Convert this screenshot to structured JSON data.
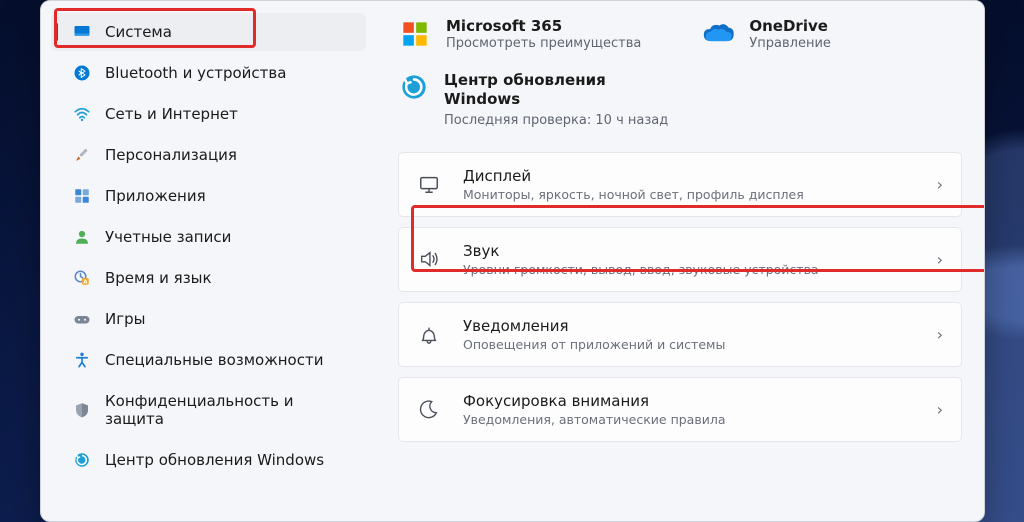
{
  "sidebar": {
    "items": [
      {
        "label": "Система",
        "icon": "display-icon",
        "active": true
      },
      {
        "label": "Bluetooth и устройства",
        "icon": "bluetooth-icon"
      },
      {
        "label": "Сеть и Интернет",
        "icon": "wifi-icon"
      },
      {
        "label": "Персонализация",
        "icon": "brush-icon"
      },
      {
        "label": "Приложения",
        "icon": "apps-icon"
      },
      {
        "label": "Учетные записи",
        "icon": "user-icon"
      },
      {
        "label": "Время и язык",
        "icon": "clock-language-icon"
      },
      {
        "label": "Игры",
        "icon": "gamepad-icon"
      },
      {
        "label": "Специальные возможности",
        "icon": "accessibility-icon"
      },
      {
        "label": "Конфиденциальность и защита",
        "icon": "shield-icon"
      },
      {
        "label": "Центр обновления Windows",
        "icon": "windows-update-icon"
      }
    ]
  },
  "promo": {
    "m365": {
      "title": "Microsoft 365",
      "sub": "Просмотреть преимущества"
    },
    "onedrive": {
      "title": "OneDrive",
      "sub": "Управление"
    }
  },
  "windows_update": {
    "title": "Центр обновления Windows",
    "sub": "Последняя проверка: 10 ч назад"
  },
  "settings_rows": [
    {
      "title": "Дисплей",
      "sub": "Мониторы, яркость, ночной свет, профиль дисплея"
    },
    {
      "title": "Звук",
      "sub": "Уровни громкости, вывод, ввод, звуковые устройства"
    },
    {
      "title": "Уведомления",
      "sub": "Оповещения от приложений и системы"
    },
    {
      "title": "Фокусировка внимания",
      "sub": "Уведомления, автоматические правила"
    }
  ]
}
